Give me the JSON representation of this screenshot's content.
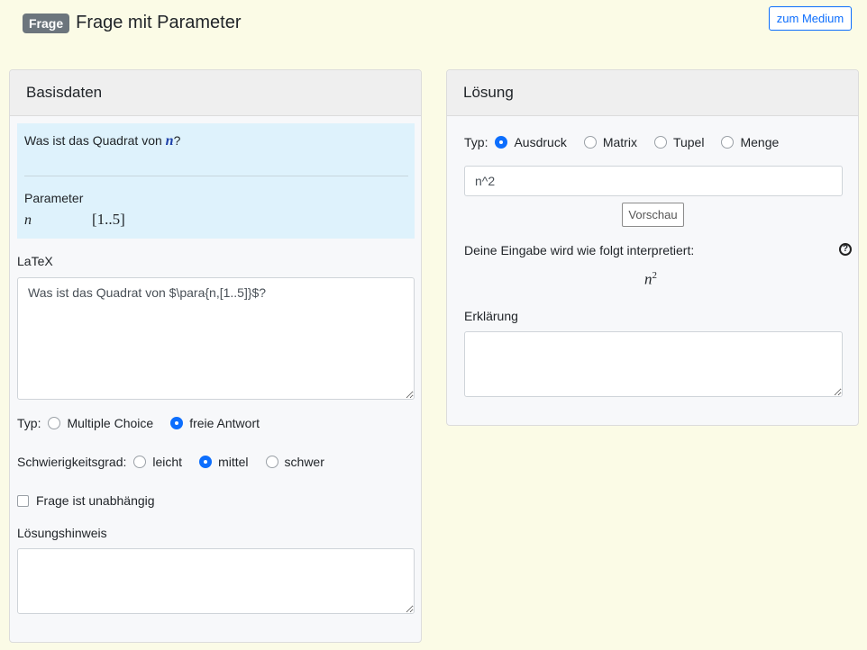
{
  "header": {
    "badge": "Frage",
    "title": "Frage mit Parameter",
    "medium_button": "zum Medium"
  },
  "basisdaten": {
    "title": "Basisdaten",
    "preview": {
      "question_prefix": "Was ist das Quadrat von ",
      "question_var": "n",
      "question_suffix": "?",
      "parameter_label": "Parameter",
      "parameter_name": "n",
      "parameter_range": "[1..5]"
    },
    "latex_label": "LaTeX",
    "latex_value": "Was ist das Quadrat von $\\para{n,[1..5]}$?",
    "typ": {
      "label": "Typ:",
      "options": [
        "Multiple Choice",
        "freie Antwort"
      ],
      "selected": "freie Antwort"
    },
    "difficulty": {
      "label": "Schwierigkeitsgrad:",
      "options": [
        "leicht",
        "mittel",
        "schwer"
      ],
      "selected": "mittel"
    },
    "independent_label": "Frage ist unabhängig",
    "independent_checked": false,
    "hint_label": "Lösungshinweis",
    "hint_value": ""
  },
  "loesung": {
    "title": "Lösung",
    "typ": {
      "label": "Typ:",
      "options": [
        "Ausdruck",
        "Matrix",
        "Tupel",
        "Menge"
      ],
      "selected": "Ausdruck"
    },
    "input_value": "n^2",
    "preview_button": "Vorschau",
    "interpret_text": "Deine Eingabe wird wie folgt interpretiert:",
    "help_icon": "?",
    "interpreted_base": "n",
    "interpreted_exp": "2",
    "explanation_label": "Erklärung",
    "explanation_value": ""
  },
  "colors": {
    "accent": "#0d6efd",
    "page_background": "#fbfbe6",
    "preview_background": "#def2fc",
    "badge": "#6c757d"
  }
}
